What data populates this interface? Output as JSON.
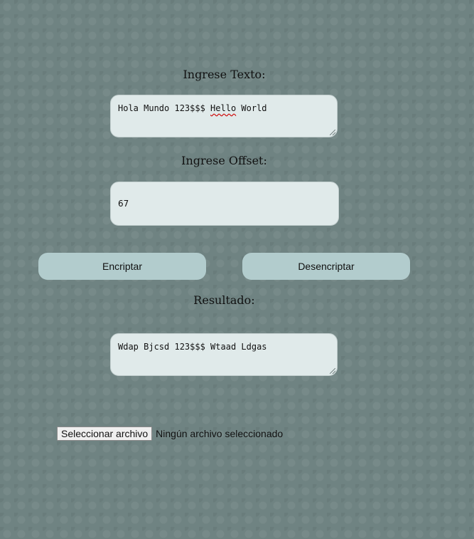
{
  "form": {
    "text_label": "Ingrese Texto:",
    "text_value_parts": [
      "Hola Mundo 123$$$ ",
      "Hello",
      " World"
    ],
    "offset_label": "Ingrese Offset:",
    "offset_value": "67",
    "encrypt_label": "Encriptar",
    "decrypt_label": "Desencriptar",
    "result_label": "Resultado:",
    "result_value": "Wdap Bjcsd 123$$$ Wtaad Ldgas"
  },
  "file": {
    "button_label": "Seleccionar archivo",
    "status": "Ningún archivo seleccionado"
  }
}
